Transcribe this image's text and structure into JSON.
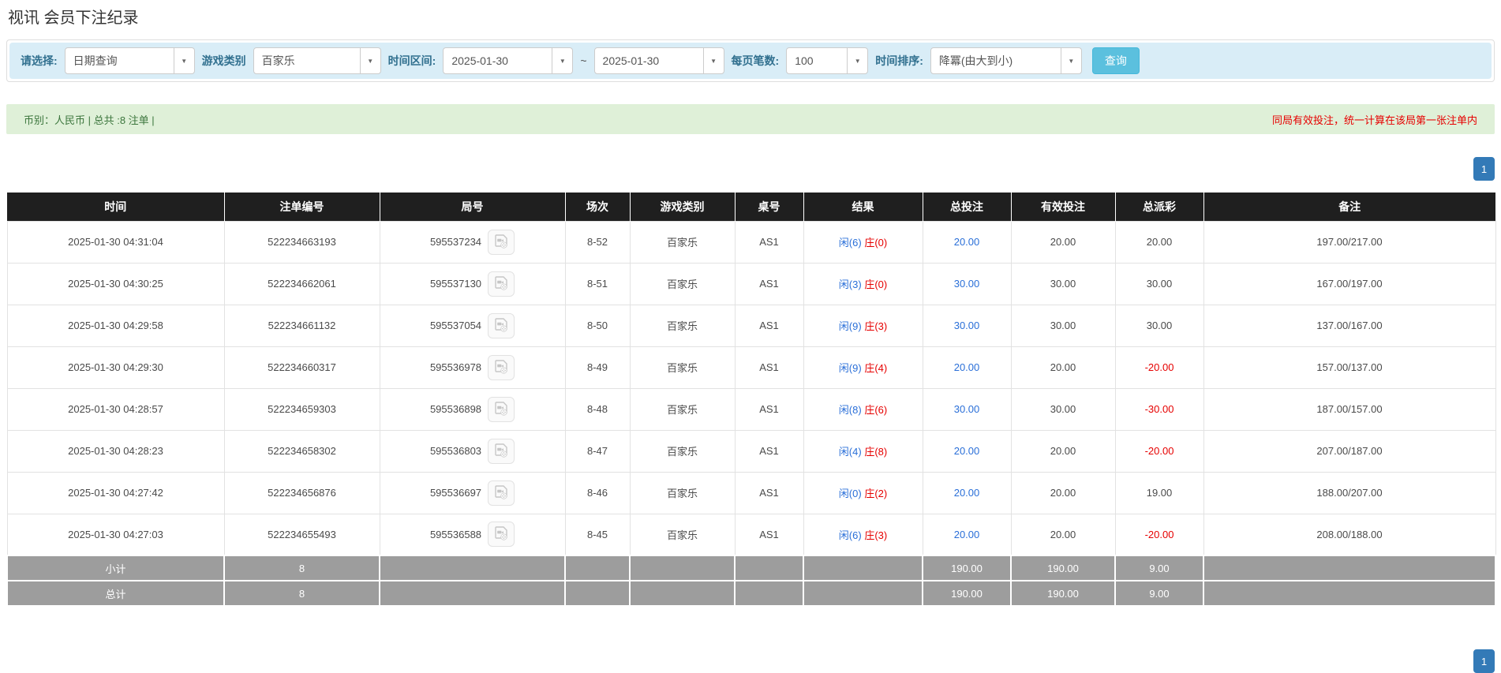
{
  "page": {
    "title": "视讯 会员下注纪录"
  },
  "colors": {
    "filter_bg": "#d9edf7",
    "label_blue": "#31708f",
    "search_button_bg": "#5bc0de",
    "summary_bar_bg": "#dff0d8",
    "summary_text_green": "#3c763d",
    "notice_red": "#e60000",
    "link_blue": "#2a6fd8",
    "pagination_blue": "#337ab7",
    "table_header_bg": "#1f1f1f",
    "summary_row_bg": "#9d9d9d"
  },
  "filters": {
    "labels": {
      "select": "请选择:",
      "game": "游戏类别",
      "range": "时间区间:",
      "tilde": "~",
      "page_size": "每页笔数:",
      "sort": "时间排序:"
    },
    "values": {
      "query_type": "日期查询",
      "game": "百家乐",
      "date_from": "2025-01-30",
      "date_to": "2025-01-30",
      "page_size": "100",
      "sort": "降冪(由大到小)"
    },
    "search_button": "查询"
  },
  "summary_bar": {
    "left": "币别：人民币 | 总共 :8 注单 |",
    "right": "同局有效投注，统一计算在该局第一张注单内"
  },
  "pagination": {
    "page": "1"
  },
  "table": {
    "headers": [
      "时间",
      "注单编号",
      "局号",
      "场次",
      "游戏类别",
      "桌号",
      "结果",
      "总投注",
      "有效投注",
      "总派彩",
      "备注"
    ],
    "rows": [
      {
        "time": "2025-01-30 04:31:04",
        "bet_id": "522234663193",
        "round_id": "595537234",
        "session": "8-52",
        "game": "百家乐",
        "table_no": "AS1",
        "result_player": "闲(6)",
        "result_banker": "庄(0)",
        "total_bet": "20.00",
        "valid_bet": "20.00",
        "payout": "20.00",
        "remark": "197.00/217.00"
      },
      {
        "time": "2025-01-30 04:30:25",
        "bet_id": "522234662061",
        "round_id": "595537130",
        "session": "8-51",
        "game": "百家乐",
        "table_no": "AS1",
        "result_player": "闲(3)",
        "result_banker": "庄(0)",
        "total_bet": "30.00",
        "valid_bet": "30.00",
        "payout": "30.00",
        "remark": "167.00/197.00"
      },
      {
        "time": "2025-01-30 04:29:58",
        "bet_id": "522234661132",
        "round_id": "595537054",
        "session": "8-50",
        "game": "百家乐",
        "table_no": "AS1",
        "result_player": "闲(9)",
        "result_banker": "庄(3)",
        "total_bet": "30.00",
        "valid_bet": "30.00",
        "payout": "30.00",
        "remark": "137.00/167.00"
      },
      {
        "time": "2025-01-30 04:29:30",
        "bet_id": "522234660317",
        "round_id": "595536978",
        "session": "8-49",
        "game": "百家乐",
        "table_no": "AS1",
        "result_player": "闲(9)",
        "result_banker": "庄(4)",
        "total_bet": "20.00",
        "valid_bet": "20.00",
        "payout": "-20.00",
        "remark": "157.00/137.00"
      },
      {
        "time": "2025-01-30 04:28:57",
        "bet_id": "522234659303",
        "round_id": "595536898",
        "session": "8-48",
        "game": "百家乐",
        "table_no": "AS1",
        "result_player": "闲(8)",
        "result_banker": "庄(6)",
        "total_bet": "30.00",
        "valid_bet": "30.00",
        "payout": "-30.00",
        "remark": "187.00/157.00"
      },
      {
        "time": "2025-01-30 04:28:23",
        "bet_id": "522234658302",
        "round_id": "595536803",
        "session": "8-47",
        "game": "百家乐",
        "table_no": "AS1",
        "result_player": "闲(4)",
        "result_banker": "庄(8)",
        "total_bet": "20.00",
        "valid_bet": "20.00",
        "payout": "-20.00",
        "remark": "207.00/187.00"
      },
      {
        "time": "2025-01-30 04:27:42",
        "bet_id": "522234656876",
        "round_id": "595536697",
        "session": "8-46",
        "game": "百家乐",
        "table_no": "AS1",
        "result_player": "闲(0)",
        "result_banker": "庄(2)",
        "total_bet": "20.00",
        "valid_bet": "20.00",
        "payout": "19.00",
        "remark": "188.00/207.00"
      },
      {
        "time": "2025-01-30 04:27:03",
        "bet_id": "522234655493",
        "round_id": "595536588",
        "session": "8-45",
        "game": "百家乐",
        "table_no": "AS1",
        "result_player": "闲(6)",
        "result_banker": "庄(3)",
        "total_bet": "20.00",
        "valid_bet": "20.00",
        "payout": "-20.00",
        "remark": "208.00/188.00"
      }
    ],
    "subtotal": {
      "label": "小计",
      "count": "8",
      "total_bet": "190.00",
      "valid_bet": "190.00",
      "payout": "9.00"
    },
    "total": {
      "label": "总计",
      "count": "8",
      "total_bet": "190.00",
      "valid_bet": "190.00",
      "payout": "9.00"
    }
  }
}
